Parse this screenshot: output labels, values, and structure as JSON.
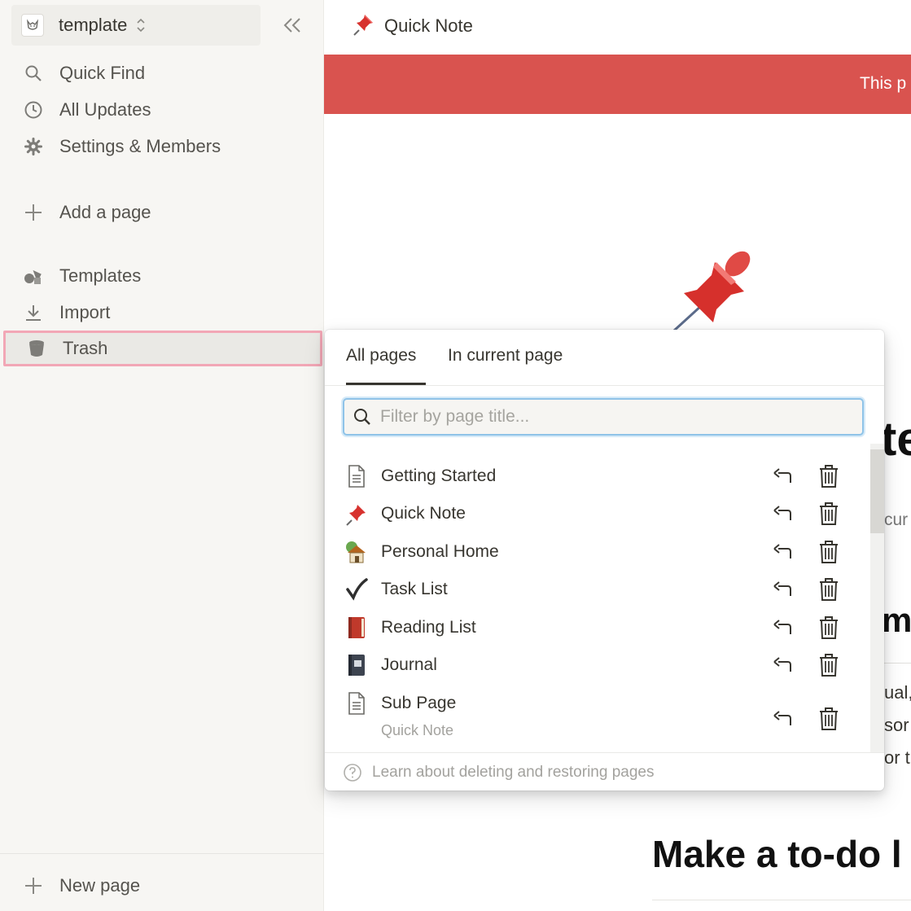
{
  "workspace": {
    "name": "template"
  },
  "sidebar": {
    "nav": [
      {
        "label": "Quick Find",
        "icon": "search-icon"
      },
      {
        "label": "All Updates",
        "icon": "clock-icon"
      },
      {
        "label": "Settings & Members",
        "icon": "gear-icon"
      }
    ],
    "add_page": "Add a page",
    "tools": [
      {
        "label": "Templates",
        "icon": "templates-icon"
      },
      {
        "label": "Import",
        "icon": "import-icon"
      },
      {
        "label": "Trash",
        "icon": "trash-icon",
        "highlighted": true
      }
    ],
    "new_page": "New page"
  },
  "topbar": {
    "title": "Quick Note",
    "icon": "pushpin-icon"
  },
  "banner": {
    "text": "This p"
  },
  "page_peek": {
    "big": "te",
    "cur": "cur",
    "m": "m",
    "line1": "ual,",
    "line2": "sor",
    "line3": "or th",
    "heading": "Make a to-do l"
  },
  "trash": {
    "tabs": [
      {
        "label": "All pages",
        "active": true
      },
      {
        "label": "In current page",
        "active": false
      }
    ],
    "filter_placeholder": "Filter by page title...",
    "items": [
      {
        "title": "Getting Started",
        "icon": "document-icon"
      },
      {
        "title": "Quick Note",
        "icon": "pushpin-icon"
      },
      {
        "title": "Personal Home",
        "icon": "house-icon"
      },
      {
        "title": "Task List",
        "icon": "checkmark-icon"
      },
      {
        "title": "Reading List",
        "icon": "red-book-icon"
      },
      {
        "title": "Journal",
        "icon": "notebook-icon"
      },
      {
        "title": "Sub Page",
        "icon": "document-icon",
        "parent": "Quick Note"
      }
    ],
    "footer": "Learn about deleting and restoring pages"
  },
  "colors": {
    "sidebar_bg": "#f7f6f3",
    "banner_red": "#d9534f",
    "highlight_border": "#f2a7b6",
    "focus_blue": "#8fc3e8"
  }
}
